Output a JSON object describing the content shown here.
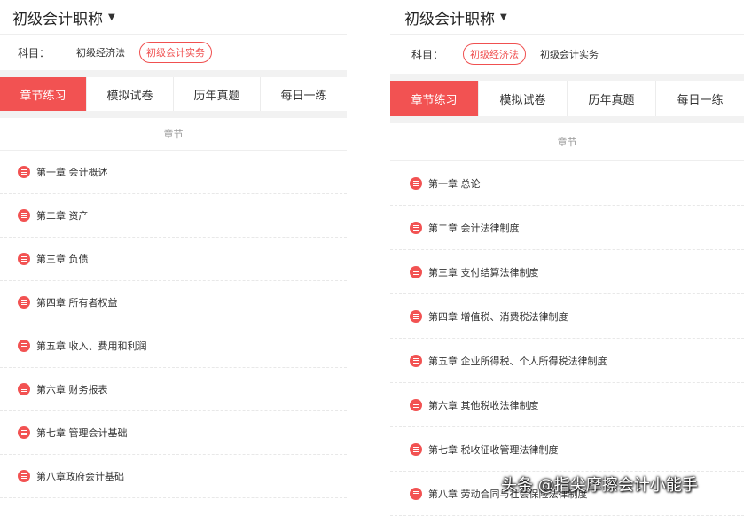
{
  "colors": {
    "accent": "#f25252",
    "chip_active": "#f05050",
    "separator": "#f2f2f2"
  },
  "left": {
    "title": "初级会计职称",
    "subject_label": "科目：",
    "subjects": [
      {
        "label": "初级经济法",
        "active": false
      },
      {
        "label": "初级会计实务",
        "active": true
      }
    ],
    "tabs": [
      {
        "label": "章节练习",
        "active": true
      },
      {
        "label": "模拟试卷",
        "active": false
      },
      {
        "label": "历年真题",
        "active": false
      },
      {
        "label": "每日一练",
        "active": false
      }
    ],
    "section_header": "章节",
    "chapters": [
      "第一章 会计概述",
      "第二章 资产",
      "第三章 负债",
      "第四章 所有者权益",
      "第五章 收入、费用和利润",
      "第六章 财务报表",
      "第七章 管理会计基础",
      "第八章政府会计基础"
    ]
  },
  "right": {
    "title": "初级会计职称",
    "subject_label": "科目：",
    "subjects": [
      {
        "label": "初级经济法",
        "active": true
      },
      {
        "label": "初级会计实务",
        "active": false
      }
    ],
    "tabs": [
      {
        "label": "章节练习",
        "active": true
      },
      {
        "label": "模拟试卷",
        "active": false
      },
      {
        "label": "历年真题",
        "active": false
      },
      {
        "label": "每日一练",
        "active": false
      }
    ],
    "section_header": "章节",
    "chapters": [
      "第一章 总论",
      "第二章 会计法律制度",
      "第三章 支付结算法律制度",
      "第四章 增值税、消费税法律制度",
      "第五章 企业所得税、个人所得税法律制度",
      "第六章 其他税收法律制度",
      "第七章 税收征收管理法律制度",
      "第八章 劳动合同与社会保险法律制度"
    ]
  },
  "watermark": "头条 @指尖摩擦会计小能手"
}
